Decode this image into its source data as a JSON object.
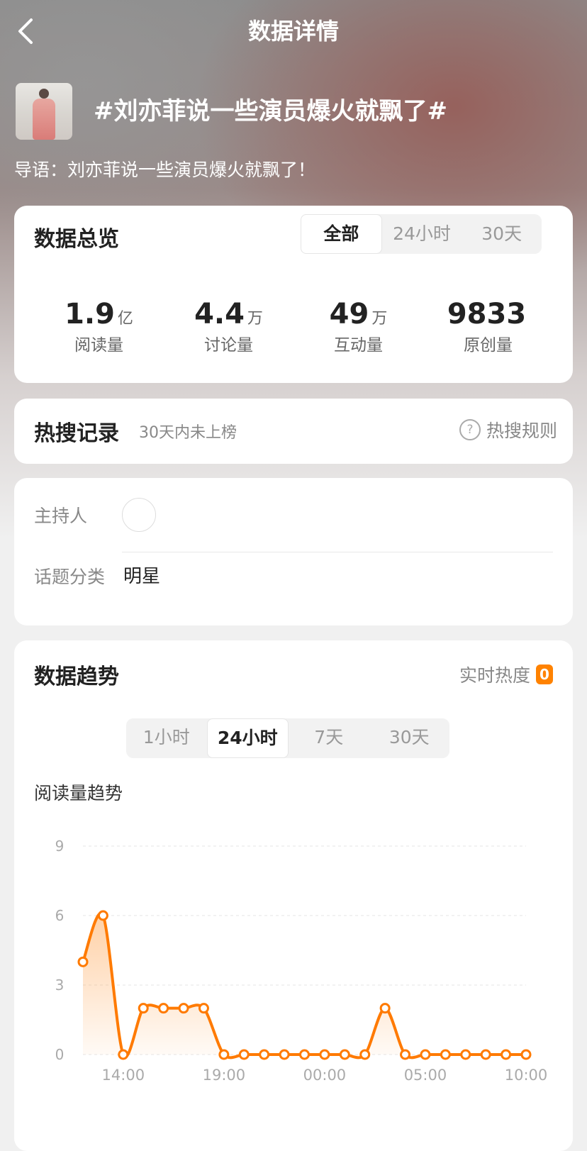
{
  "nav": {
    "title": "数据详情"
  },
  "topic": {
    "title": "#刘亦菲说一些演员爆火就飘了#",
    "intro": "导语：刘亦菲说一些演员爆火就飘了！"
  },
  "overview": {
    "title": "数据总览",
    "tabs": [
      "全部",
      "24小时",
      "30天"
    ],
    "active_tab": 0,
    "stats": [
      {
        "value": "1.9",
        "unit": "亿",
        "label": "阅读量"
      },
      {
        "value": "4.4",
        "unit": "万",
        "label": "讨论量"
      },
      {
        "value": "49",
        "unit": "万",
        "label": "互动量"
      },
      {
        "value": "9833",
        "unit": "",
        "label": "原创量"
      }
    ]
  },
  "hot_search": {
    "title": "热搜记录",
    "subtitle": "30天内未上榜",
    "rules_label": "热搜规则",
    "rules_icon": "question-circle-icon"
  },
  "info": {
    "host_label": "主持人",
    "category_label": "话题分类",
    "category_value": "明星"
  },
  "trend": {
    "title": "数据趋势",
    "heat_label": "实时热度",
    "heat_value": "0",
    "tabs": [
      "1小时",
      "24小时",
      "7天",
      "30天"
    ],
    "active_tab": 1,
    "chart_label": "阅读量趋势"
  },
  "chart_data": {
    "type": "area",
    "title": "阅读量趋势",
    "xlabel": "",
    "ylabel": "",
    "ylim": [
      0,
      9
    ],
    "yticks": [
      0,
      3,
      6,
      9
    ],
    "xtick_labels": [
      "14:00",
      "19:00",
      "00:00",
      "05:00",
      "10:00"
    ],
    "x": [
      "12:00",
      "13:00",
      "14:00",
      "15:00",
      "16:00",
      "17:00",
      "18:00",
      "19:00",
      "20:00",
      "21:00",
      "22:00",
      "23:00",
      "00:00",
      "01:00",
      "02:00",
      "03:00",
      "04:00",
      "05:00",
      "06:00",
      "07:00",
      "08:00",
      "09:00",
      "10:00"
    ],
    "series": [
      {
        "values": [
          4,
          6,
          0,
          2,
          2,
          2,
          2,
          0,
          0,
          0,
          0,
          0,
          0,
          0,
          0,
          2,
          0,
          0,
          0,
          0,
          0,
          0,
          0
        ]
      }
    ],
    "grid": true,
    "color": "#ff7a00"
  }
}
